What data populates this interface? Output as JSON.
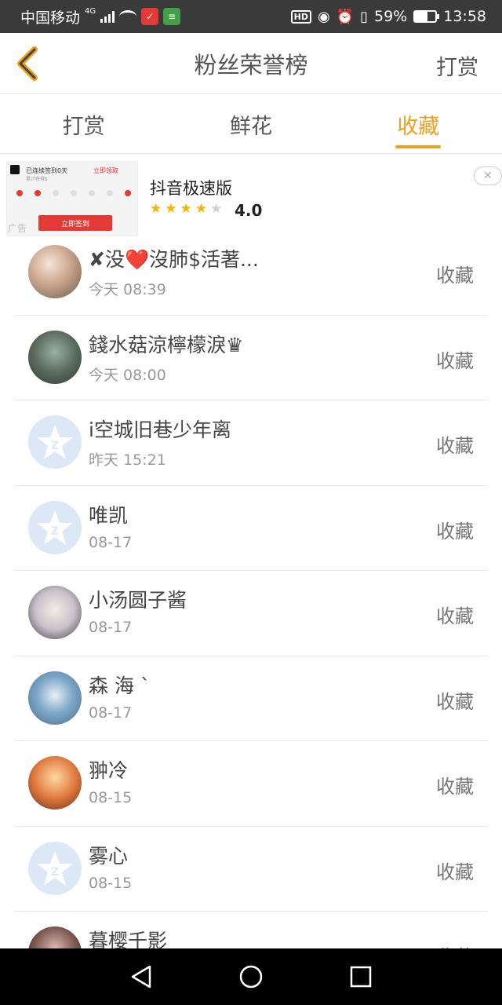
{
  "status_bar": {
    "carrier": "中国移动",
    "network": "4G",
    "battery_percent": "59%",
    "battery_level": 0.59,
    "time": "13:58",
    "hd": "HD"
  },
  "header": {
    "title": "粉丝荣誉榜",
    "action_label": "打赏"
  },
  "tabs": [
    {
      "label": "打赏",
      "active": false
    },
    {
      "label": "鲜花",
      "active": false
    },
    {
      "label": "收藏",
      "active": true
    }
  ],
  "ad": {
    "app_name": "抖音极速版",
    "rating": "4.0",
    "rating_value": 4,
    "ad_label": "广告",
    "thumb_line1": "已连续签到0天",
    "thumb_line2": "累计获得$",
    "thumb_clock": "立即领取",
    "thumb_button": "立即签到",
    "close_label": "✕"
  },
  "list": [
    {
      "name": "✘没❤️沒肺$活著...",
      "time": "今天 08:39",
      "action": "收藏",
      "avatar": "photo"
    },
    {
      "name": "錢水菇涼檸檬淚♛",
      "time": "今天 08:00",
      "action": "收藏",
      "avatar": "photo"
    },
    {
      "name": "i空城旧巷少年离",
      "time": "昨天 15:21",
      "action": "收藏",
      "avatar": "default"
    },
    {
      "name": "唯凯",
      "time": "08-17",
      "action": "收藏",
      "avatar": "default"
    },
    {
      "name": "小汤圆子酱",
      "time": "08-17",
      "action": "收藏",
      "avatar": "photo"
    },
    {
      "name": "森 海 ˋ",
      "time": "08-17",
      "action": "收藏",
      "avatar": "photo"
    },
    {
      "name": "翀冷",
      "time": "08-15",
      "action": "收藏",
      "avatar": "photo"
    },
    {
      "name": "雾心",
      "time": "08-15",
      "action": "收藏",
      "avatar": "default"
    },
    {
      "name": "暮樱千影",
      "time": "",
      "action": "收藏",
      "avatar": "photo"
    }
  ],
  "colors": {
    "accent": "#f0a020",
    "status_bar": "#3a3a3a",
    "nav_bar": "#000000"
  },
  "icons": {
    "back": "chevron-left-icon",
    "default_avatar": "qq-star-icon",
    "nav_back": "triangle-back-icon",
    "nav_home": "circle-home-icon",
    "nav_recents": "square-recents-icon"
  }
}
